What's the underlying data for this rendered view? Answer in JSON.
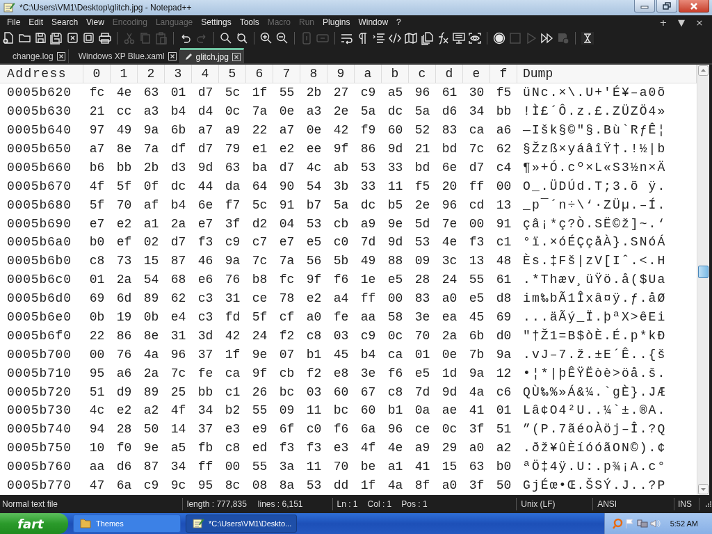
{
  "window": {
    "title": "*C:\\Users\\VM1\\Desktop\\glitch.jpg - Notepad++"
  },
  "menu": [
    {
      "label": "File",
      "disabled": false
    },
    {
      "label": "Edit",
      "disabled": false
    },
    {
      "label": "Search",
      "disabled": false
    },
    {
      "label": "View",
      "disabled": false
    },
    {
      "label": "Encoding",
      "disabled": true
    },
    {
      "label": "Language",
      "disabled": true
    },
    {
      "label": "Settings",
      "disabled": false
    },
    {
      "label": "Tools",
      "disabled": false
    },
    {
      "label": "Macro",
      "disabled": true
    },
    {
      "label": "Run",
      "disabled": true
    },
    {
      "label": "Plugins",
      "disabled": false
    },
    {
      "label": "Window",
      "disabled": false
    },
    {
      "label": "?",
      "disabled": false
    }
  ],
  "menu_controls": [
    "+",
    "▼",
    "×"
  ],
  "toolbar": [
    {
      "kind": "new",
      "disabled": false
    },
    {
      "kind": "open",
      "disabled": false
    },
    {
      "kind": "save",
      "disabled": false
    },
    {
      "kind": "saveall",
      "disabled": false
    },
    {
      "kind": "close",
      "disabled": false
    },
    {
      "kind": "closeall",
      "disabled": false
    },
    {
      "kind": "print",
      "disabled": false
    },
    {
      "kind": "separator"
    },
    {
      "kind": "cut",
      "disabled": true
    },
    {
      "kind": "copy",
      "disabled": true
    },
    {
      "kind": "paste",
      "disabled": true
    },
    {
      "kind": "separator"
    },
    {
      "kind": "undo",
      "disabled": false
    },
    {
      "kind": "redo",
      "disabled": true
    },
    {
      "kind": "separator"
    },
    {
      "kind": "find",
      "disabled": false
    },
    {
      "kind": "replace",
      "disabled": false
    },
    {
      "kind": "separator"
    },
    {
      "kind": "zoomin",
      "disabled": false
    },
    {
      "kind": "zoomout",
      "disabled": false
    },
    {
      "kind": "separator"
    },
    {
      "kind": "syncv",
      "disabled": true
    },
    {
      "kind": "synch",
      "disabled": true
    },
    {
      "kind": "separator"
    },
    {
      "kind": "wrap",
      "disabled": false
    },
    {
      "kind": "pilcrow",
      "disabled": false
    },
    {
      "kind": "indent",
      "disabled": false
    },
    {
      "kind": "code",
      "disabled": false
    },
    {
      "kind": "map",
      "disabled": false
    },
    {
      "kind": "pages",
      "disabled": false
    },
    {
      "kind": "fx",
      "disabled": false
    },
    {
      "kind": "monitor",
      "disabled": false
    },
    {
      "kind": "eye",
      "disabled": false
    },
    {
      "kind": "separator"
    },
    {
      "kind": "record",
      "disabled": false
    },
    {
      "kind": "stop",
      "disabled": true
    },
    {
      "kind": "play",
      "disabled": true
    },
    {
      "kind": "playmulti",
      "disabled": false
    },
    {
      "kind": "saverec",
      "disabled": true
    },
    {
      "kind": "separator"
    },
    {
      "kind": "trim",
      "disabled": false
    }
  ],
  "tabs": [
    {
      "label": "change.log",
      "selected": false,
      "modified": false
    },
    {
      "label": "Windows XP Blue.xaml",
      "selected": false,
      "modified": false
    },
    {
      "label": "glitch.jpg",
      "selected": true,
      "modified": true
    }
  ],
  "hex": {
    "columns": [
      "Address",
      "0",
      "1",
      "2",
      "3",
      "4",
      "5",
      "6",
      "7",
      "8",
      "9",
      "a",
      "b",
      "c",
      "d",
      "e",
      "f",
      "Dump"
    ],
    "rows": [
      {
        "address": "0005b620",
        "bytes": [
          "fc",
          "4e",
          "63",
          "01",
          "d7",
          "5c",
          "1f",
          "55",
          "2b",
          "27",
          "c9",
          "a5",
          "96",
          "61",
          "30",
          "f5"
        ],
        "dump": "üNc.×\\.U+'É¥–a0õ"
      },
      {
        "address": "0005b630",
        "bytes": [
          "21",
          "cc",
          "a3",
          "b4",
          "d4",
          "0c",
          "7a",
          "0e",
          "a3",
          "2e",
          "5a",
          "dc",
          "5a",
          "d6",
          "34",
          "bb"
        ],
        "dump": "!Ì£´Ô.z.£.ZÜZÖ4»"
      },
      {
        "address": "0005b640",
        "bytes": [
          "97",
          "49",
          "9a",
          "6b",
          "a7",
          "a9",
          "22",
          "a7",
          "0e",
          "42",
          "f9",
          "60",
          "52",
          "83",
          "ca",
          "a6"
        ],
        "dump": "—Išk§©\"§.Bù`RƒÊ¦"
      },
      {
        "address": "0005b650",
        "bytes": [
          "a7",
          "8e",
          "7a",
          "df",
          "d7",
          "79",
          "e1",
          "e2",
          "ee",
          "9f",
          "86",
          "9d",
          "21",
          "bd",
          "7c",
          "62"
        ],
        "dump": "§Žzß×yáâîŸ†.!½|b"
      },
      {
        "address": "0005b660",
        "bytes": [
          "b6",
          "bb",
          "2b",
          "d3",
          "9d",
          "63",
          "ba",
          "d7",
          "4c",
          "ab",
          "53",
          "33",
          "bd",
          "6e",
          "d7",
          "c4"
        ],
        "dump": "¶»+Ó.cº×L«S3½n×Ä"
      },
      {
        "address": "0005b670",
        "bytes": [
          "4f",
          "5f",
          "0f",
          "dc",
          "44",
          "da",
          "64",
          "90",
          "54",
          "3b",
          "33",
          "11",
          "f5",
          "20",
          "ff",
          "00"
        ],
        "dump": "O_.ÜDÚd.T;3.õ ÿ."
      },
      {
        "address": "0005b680",
        "bytes": [
          "5f",
          "70",
          "af",
          "b4",
          "6e",
          "f7",
          "5c",
          "91",
          "b7",
          "5a",
          "dc",
          "b5",
          "2e",
          "96",
          "cd",
          "13"
        ],
        "dump": "_p¯´n÷\\‘·ZÜµ.–Í."
      },
      {
        "address": "0005b690",
        "bytes": [
          "e7",
          "e2",
          "a1",
          "2a",
          "e7",
          "3f",
          "d2",
          "04",
          "53",
          "cb",
          "a9",
          "9e",
          "5d",
          "7e",
          "00",
          "91"
        ],
        "dump": "çâ¡*ç?Ò.SË©ž]~.‘"
      },
      {
        "address": "0005b6a0",
        "bytes": [
          "b0",
          "ef",
          "02",
          "d7",
          "f3",
          "c9",
          "c7",
          "e7",
          "e5",
          "c0",
          "7d",
          "9d",
          "53",
          "4e",
          "f3",
          "c1"
        ],
        "dump": "°ï.×óÉÇçåÀ}.SNóÁ"
      },
      {
        "address": "0005b6b0",
        "bytes": [
          "c8",
          "73",
          "15",
          "87",
          "46",
          "9a",
          "7c",
          "7a",
          "56",
          "5b",
          "49",
          "88",
          "09",
          "3c",
          "13",
          "48"
        ],
        "dump": "Ès.‡Fš|zV[Iˆ.<.H"
      },
      {
        "address": "0005b6c0",
        "bytes": [
          "01",
          "2a",
          "54",
          "68",
          "e6",
          "76",
          "b8",
          "fc",
          "9f",
          "f6",
          "1e",
          "e5",
          "28",
          "24",
          "55",
          "61"
        ],
        "dump": ".*Thæv¸üŸö.å($Ua"
      },
      {
        "address": "0005b6d0",
        "bytes": [
          "69",
          "6d",
          "89",
          "62",
          "c3",
          "31",
          "ce",
          "78",
          "e2",
          "a4",
          "ff",
          "00",
          "83",
          "a0",
          "e5",
          "d8"
        ],
        "dump": "im‰bÃ1Îxâ¤ÿ.ƒ.åØ"
      },
      {
        "address": "0005b6e0",
        "bytes": [
          "0b",
          "19",
          "0b",
          "e4",
          "c3",
          "fd",
          "5f",
          "cf",
          "a0",
          "fe",
          "aa",
          "58",
          "3e",
          "ea",
          "45",
          "69"
        ],
        "dump": "...äÃý_Ï.þªX>êEi"
      },
      {
        "address": "0005b6f0",
        "bytes": [
          "22",
          "86",
          "8e",
          "31",
          "3d",
          "42",
          "24",
          "f2",
          "c8",
          "03",
          "c9",
          "0c",
          "70",
          "2a",
          "6b",
          "d0"
        ],
        "dump": "\"†Ž1=B$òÈ.É.p*kÐ"
      },
      {
        "address": "0005b700",
        "bytes": [
          "00",
          "76",
          "4a",
          "96",
          "37",
          "1f",
          "9e",
          "07",
          "b1",
          "45",
          "b4",
          "ca",
          "01",
          "0e",
          "7b",
          "9a"
        ],
        "dump": ".vJ–7.ž.±E´Ê..{š"
      },
      {
        "address": "0005b710",
        "bytes": [
          "95",
          "a6",
          "2a",
          "7c",
          "fe",
          "ca",
          "9f",
          "cb",
          "f2",
          "e8",
          "3e",
          "f6",
          "e5",
          "1d",
          "9a",
          "12"
        ],
        "dump": "•¦*|þÊŸËòè>öå.š."
      },
      {
        "address": "0005b720",
        "bytes": [
          "51",
          "d9",
          "89",
          "25",
          "bb",
          "c1",
          "26",
          "bc",
          "03",
          "60",
          "67",
          "c8",
          "7d",
          "9d",
          "4a",
          "c6"
        ],
        "dump": "QÙ‰%»Á&¼.`gÈ}.JÆ"
      },
      {
        "address": "0005b730",
        "bytes": [
          "4c",
          "e2",
          "a2",
          "4f",
          "34",
          "b2",
          "55",
          "09",
          "11",
          "bc",
          "60",
          "b1",
          "0a",
          "ae",
          "41",
          "01"
        ],
        "dump": "Lâ¢O4²U..¼`±.®A."
      },
      {
        "address": "0005b740",
        "bytes": [
          "94",
          "28",
          "50",
          "14",
          "37",
          "e3",
          "e9",
          "6f",
          "c0",
          "f6",
          "6a",
          "96",
          "ce",
          "0c",
          "3f",
          "51"
        ],
        "dump": "”(P.7ãéoÀöj–Î.?Q"
      },
      {
        "address": "0005b750",
        "bytes": [
          "10",
          "f0",
          "9e",
          "a5",
          "fb",
          "c8",
          "ed",
          "f3",
          "f3",
          "e3",
          "4f",
          "4e",
          "a9",
          "29",
          "a0",
          "a2"
        ],
        "dump": ".ðž¥ûÈíóóãON©).¢"
      },
      {
        "address": "0005b760",
        "bytes": [
          "aa",
          "d6",
          "87",
          "34",
          "ff",
          "00",
          "55",
          "3a",
          "11",
          "70",
          "be",
          "a1",
          "41",
          "15",
          "63",
          "b0"
        ],
        "dump": "ªÖ‡4ÿ.U:.p¾¡A.c°"
      },
      {
        "address": "0005b770",
        "bytes": [
          "47",
          "6a",
          "c9",
          "9c",
          "95",
          "8c",
          "08",
          "8a",
          "53",
          "dd",
          "1f",
          "4a",
          "8f",
          "a0",
          "3f",
          "50"
        ],
        "dump": "GjÉœ•Œ.ŠSÝ.J..?P"
      }
    ]
  },
  "status_bar": [
    {
      "kind": "type",
      "texts": [
        "Normal text file"
      ]
    },
    {
      "kind": "size",
      "texts": [
        "length : 777,835",
        "lines : 6,151"
      ]
    },
    {
      "kind": "position",
      "texts": [
        "Ln : 1",
        "Col : 1",
        "Pos : 1"
      ]
    },
    {
      "kind": "eol",
      "texts": [
        "Unix (LF)"
      ]
    },
    {
      "kind": "encoding",
      "texts": [
        "ANSI"
      ]
    },
    {
      "kind": "mode",
      "texts": [
        "INS"
      ]
    }
  ],
  "taskbar": {
    "start": "fart",
    "tasks": [
      {
        "label": "Themes",
        "kind": "folder",
        "selected": false
      },
      {
        "label": "*C:\\Users\\VM1\\Deskto...",
        "kind": "notepad",
        "selected": true
      }
    ],
    "time": "5:52 AM"
  }
}
